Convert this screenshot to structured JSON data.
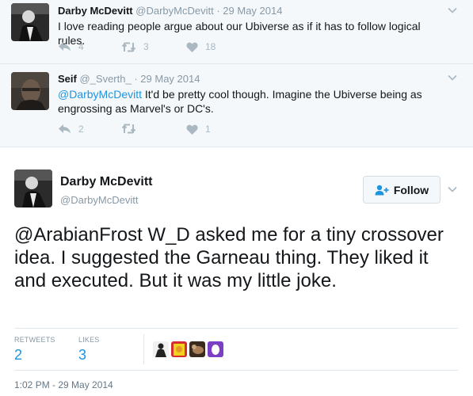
{
  "replies": [
    {
      "name": "Darby McDevitt",
      "handle": "@DarbyMcDevitt",
      "date": "29 May 2014",
      "text": "I love reading people argue about our Ubiverse as if it has to follow logical rules.",
      "mention": "",
      "reply_count": "4",
      "retweet_count": "3",
      "like_count": "18"
    },
    {
      "name": "Seif",
      "handle": "@_Sverth_",
      "date": "29 May 2014",
      "mention": "@DarbyMcDevitt",
      "text": " It'd be pretty cool though. Imagine the Ubiverse being as engrossing as Marvel's or DC's.",
      "reply_count": "2",
      "retweet_count": "",
      "like_count": "1"
    }
  ],
  "main": {
    "name": "Darby McDevitt",
    "handle": "@DarbyMcDevitt",
    "follow_label": "Follow",
    "text": "@ArabianFrost W_D asked me for a tiny crossover idea. I suggested the Garneau thing. They liked it and executed. But it was my little joke.",
    "retweets_label": "RETWEETS",
    "retweets_value": "2",
    "likes_label": "LIKES",
    "likes_value": "3",
    "timestamp": "1:02 PM - 29 May 2014"
  },
  "icons": {
    "reply": "reply-icon",
    "retweet": "retweet-icon",
    "like": "heart-icon",
    "caret": "chevron-down-icon",
    "follow": "add-user-icon"
  },
  "colors": {
    "link": "#1b95e0",
    "muted": "#8899a6",
    "icon": "#aab8c2",
    "reply_bg": "#f5f8fa"
  }
}
